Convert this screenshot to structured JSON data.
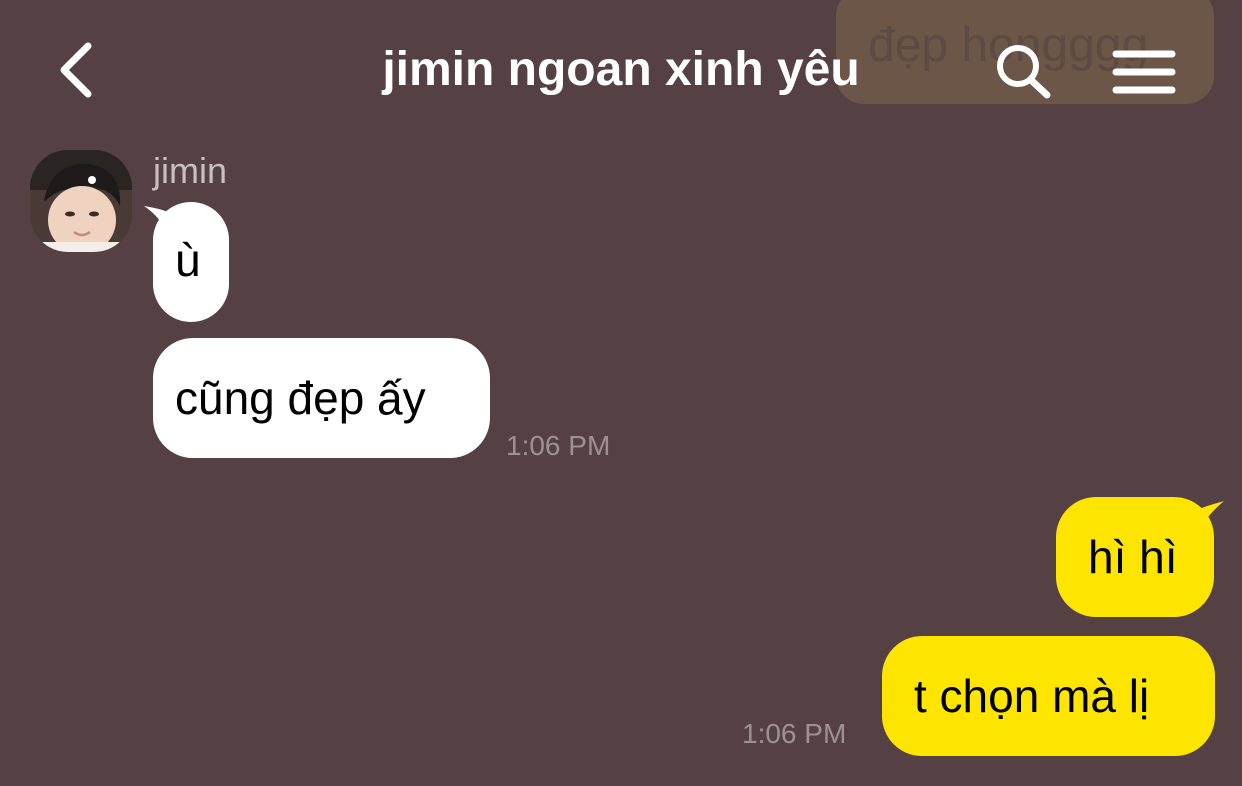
{
  "header": {
    "title": "jimin ngoan xinh yêu",
    "back_icon": "chevron-left-icon",
    "search_icon": "search-icon",
    "menu_icon": "menu-icon"
  },
  "faded_message": {
    "text": "đẹp hongggg"
  },
  "conversation": {
    "incoming": {
      "sender": "jimin",
      "messages": [
        "ù",
        "cũng đẹp ấy"
      ],
      "time": "1:06 PM"
    },
    "outgoing": {
      "messages": [
        "hì hì",
        "t chọn mà lị"
      ],
      "time": "1:06 PM"
    }
  },
  "colors": {
    "background": "#554143",
    "incoming_bubble": "#ffffff",
    "outgoing_bubble": "#fee500",
    "timestamp": "#9d9192",
    "title": "#ffffff"
  }
}
